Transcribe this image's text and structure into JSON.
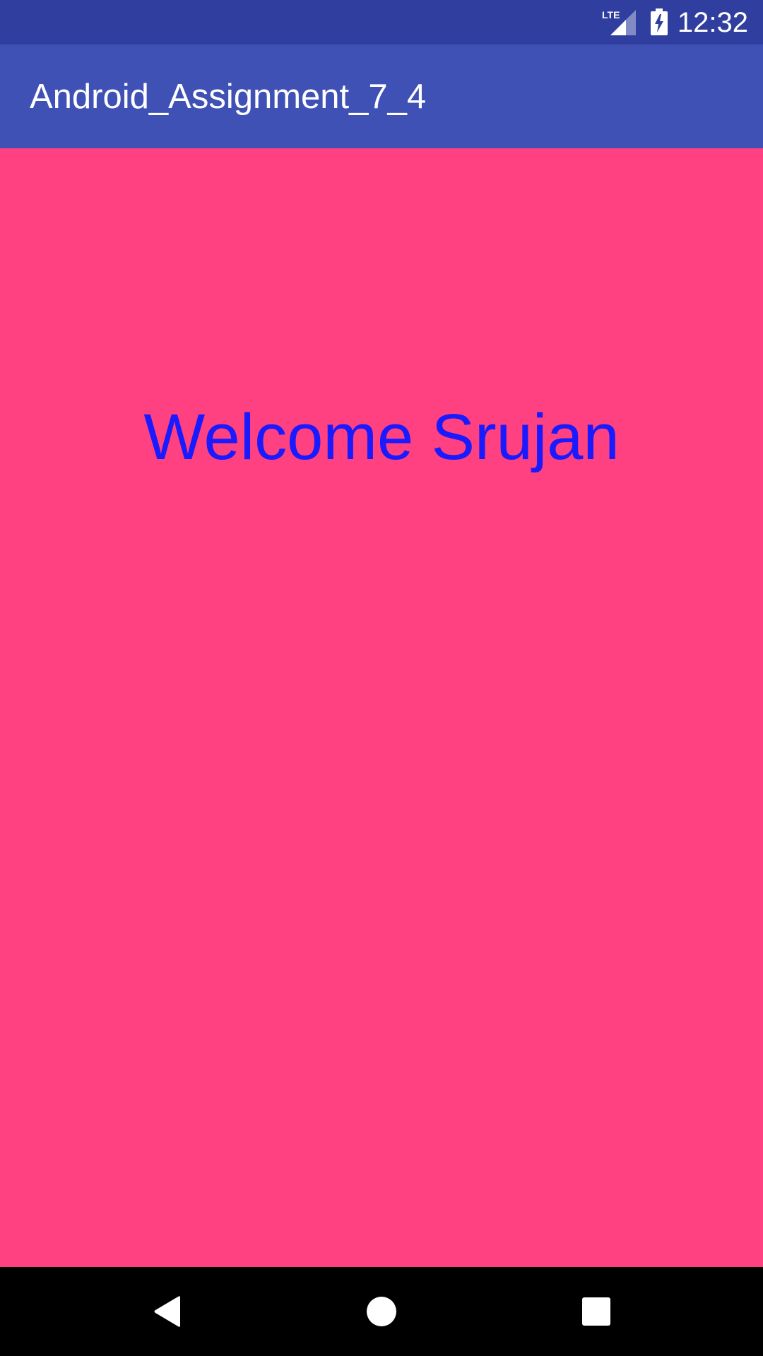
{
  "status_bar": {
    "network_label": "LTE",
    "time": "12:32",
    "network_icon": "lte-signal-icon",
    "battery_icon": "battery-charging-icon"
  },
  "app_bar": {
    "title": "Android_Assignment_7_4"
  },
  "main": {
    "welcome_text": "Welcome Srujan"
  },
  "nav_bar": {
    "back_icon": "back-icon",
    "home_icon": "home-icon",
    "recents_icon": "recents-icon"
  },
  "colors": {
    "status_bar": "#303f9f",
    "app_bar": "#3f51b5",
    "background": "#ff4081",
    "welcome_text": "#1a1aff",
    "nav_bar": "#000000"
  }
}
